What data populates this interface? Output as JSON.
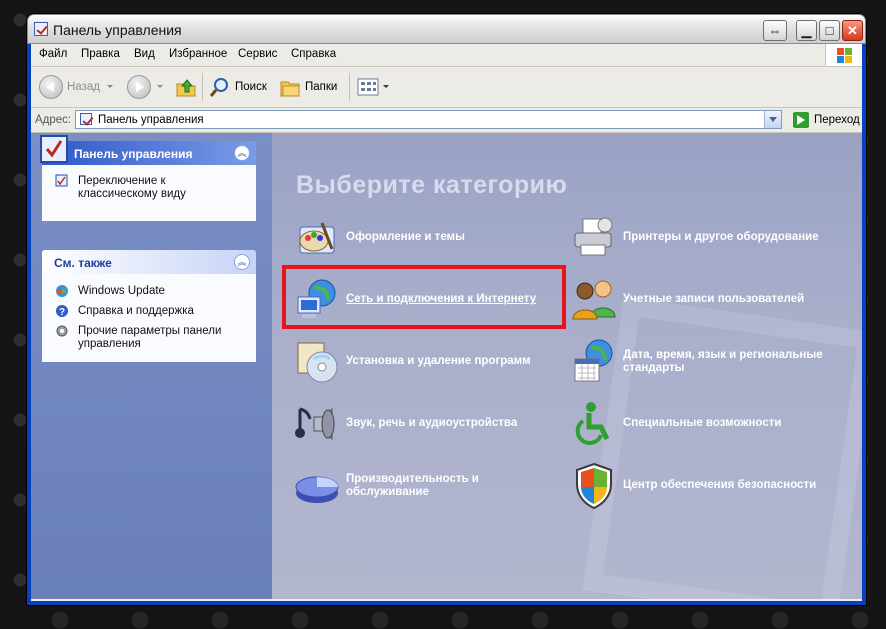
{
  "window": {
    "title": "Панель управления",
    "buttons": {
      "restore": "⇔",
      "minimize": "▁",
      "maximize": "□",
      "close": "✕"
    }
  },
  "menubar": {
    "items": [
      "Файл",
      "Правка",
      "Вид",
      "Избранное",
      "Сервис",
      "Справка"
    ]
  },
  "toolbar": {
    "back_label": "Назад",
    "search_label": "Поиск",
    "folders_label": "Папки"
  },
  "address": {
    "label": "Адрес:",
    "value": "Панель управления",
    "go_label": "Переход"
  },
  "sidebar": {
    "panel1": {
      "title": "Панель управления",
      "links": [
        {
          "label": "Переключение к классическому виду",
          "icon": "control-panel-icon"
        }
      ]
    },
    "panel2": {
      "title": "См. также",
      "links": [
        {
          "label": "Windows Update",
          "icon": "windows-update-icon"
        },
        {
          "label": "Справка и поддержка",
          "icon": "help-icon"
        },
        {
          "label": "Прочие параметры панели управления",
          "icon": "gear-icon"
        }
      ]
    }
  },
  "main": {
    "heading": "Выберите категорию",
    "categories": [
      {
        "label": "Оформление и темы",
        "icon": "appearance-icon"
      },
      {
        "label": "Принтеры и другое оборудование",
        "icon": "printer-icon"
      },
      {
        "label": "Сеть и подключения к Интернету",
        "icon": "network-icon"
      },
      {
        "label": "Учетные записи пользователей",
        "icon": "users-icon"
      },
      {
        "label": "Установка и удаление программ",
        "icon": "add-remove-programs-icon"
      },
      {
        "label": "Дата, время, язык и региональные стандарты",
        "icon": "date-time-icon"
      },
      {
        "label": "Звук, речь и аудиоустройства",
        "icon": "sound-icon"
      },
      {
        "label": "Специальные возможности",
        "icon": "accessibility-icon"
      },
      {
        "label": "Производительность и обслуживание",
        "icon": "performance-icon"
      },
      {
        "label": "Центр обеспечения безопасности",
        "icon": "security-center-icon"
      }
    ]
  },
  "colors": {
    "highlight": "#e5141d",
    "main_bg": "#a9aecb",
    "sidebar_bg": "#7a8fc6"
  }
}
